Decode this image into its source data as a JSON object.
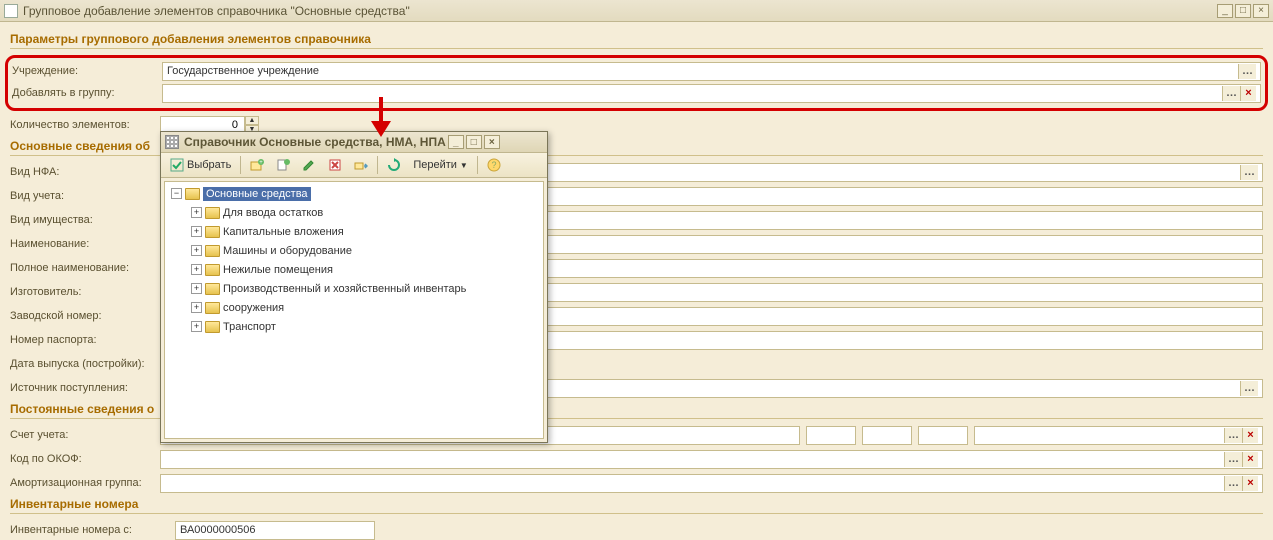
{
  "window": {
    "title": "Групповое добавление элементов справочника \"Основные средства\""
  },
  "sections": {
    "params": "Параметры группового добавления элементов справочника",
    "main": "Основные сведения об",
    "perm": "Постоянные сведения о",
    "inv": "Инвентарные номера"
  },
  "labels": {
    "org": "Учреждение:",
    "add_to_group": "Добавлять в группу:",
    "count": "Количество элементов:",
    "nfa_type": "Вид НФА:",
    "acc_type": "Вид учета:",
    "prop_type": "Вид имущества:",
    "name": "Наименование:",
    "full_name": "Полное наименование:",
    "maker": "Изготовитель:",
    "factory_no": "Заводской номер:",
    "passport_no": "Номер паспорта:",
    "release_date": "Дата выпуска (постройки):",
    "source": "Источник поступления:",
    "account": "Счет учета:",
    "okof": "Код по ОКОФ:",
    "amort": "Амортизационная группа:",
    "inv_start": "Инвентарные номера с:"
  },
  "values": {
    "org": "Государственное учреждение",
    "add_to_group": "",
    "count": "0",
    "inv_start": "ВА0000000506"
  },
  "dialog": {
    "title": "Справочник Основные средства, НМА, НПА",
    "select_btn": "Выбрать",
    "goto_btn": "Перейти",
    "tree_root": "Основные средства",
    "tree_items": [
      "Для ввода остатков",
      "Капитальные вложения",
      "Машины и оборудование",
      "Нежилые помещения",
      "Производственный и хозяйственный инвентарь",
      "сооружения",
      "Транспорт"
    ]
  }
}
